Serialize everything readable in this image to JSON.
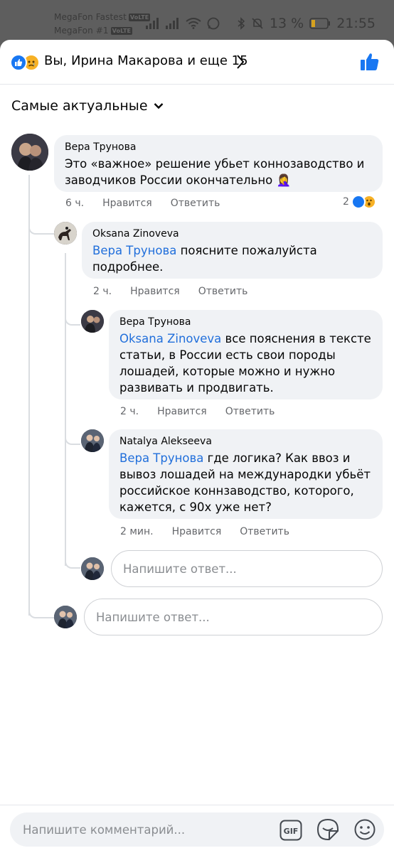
{
  "status_bar": {
    "carrier1": "MegaFon Fastest",
    "carrier2": "MegaFon #1",
    "volte": "VoLTE",
    "battery": "13 %",
    "time": "21:55"
  },
  "header": {
    "title": "Вы, Ирина Макарова и еще 15",
    "reactions": [
      "like-icon",
      "sad-icon"
    ]
  },
  "sort": {
    "label": "Самые актуальные"
  },
  "comments": [
    {
      "author": "Вера Трунова",
      "mention": "",
      "text": "Это «важное» решение убьет коннозаводство и заводчиков России окончательно 🤦‍♀️",
      "time": "6 ч.",
      "like_label": "Нравится",
      "reply_label": "Ответить",
      "reaction_count": "2"
    },
    {
      "author": "Oksana Zinoveva",
      "mention": "Вера Трунова",
      "text": "поясните пожалуйста подробнее.",
      "time": "2 ч.",
      "like_label": "Нравится",
      "reply_label": "Ответить"
    },
    {
      "author": "Вера Трунова",
      "mention": "Oksana Zinoveva",
      "text": "все пояснения в тексте статьи, в России есть свои породы лошадей, которые можно и нужно развивать и продвигать.",
      "time": "2 ч.",
      "like_label": "Нравится",
      "reply_label": "Ответить"
    },
    {
      "author": "Natalya Alekseeva",
      "mention": "Вера Трунова",
      "text": "где логика? Как ввоз и вывоз лошадей на международки убьёт российское коннзаводство, которого, кажется, с 90х уже нет?",
      "time": "2 мин.",
      "like_label": "Нравится",
      "reply_label": "Ответить"
    }
  ],
  "reply_inputs": {
    "nested_placeholder": "Напишите ответ...",
    "thread_placeholder": "Напишите ответ..."
  },
  "composer": {
    "placeholder": "Напишите комментарий...",
    "gif_label": "GIF",
    "icons": [
      "gif-icon",
      "sticker-icon",
      "emoji-icon"
    ]
  },
  "colors": {
    "accent": "#1877f2",
    "mention": "#216fdb",
    "bubble": "#f0f2f5",
    "secondary_text": "#65676b"
  }
}
